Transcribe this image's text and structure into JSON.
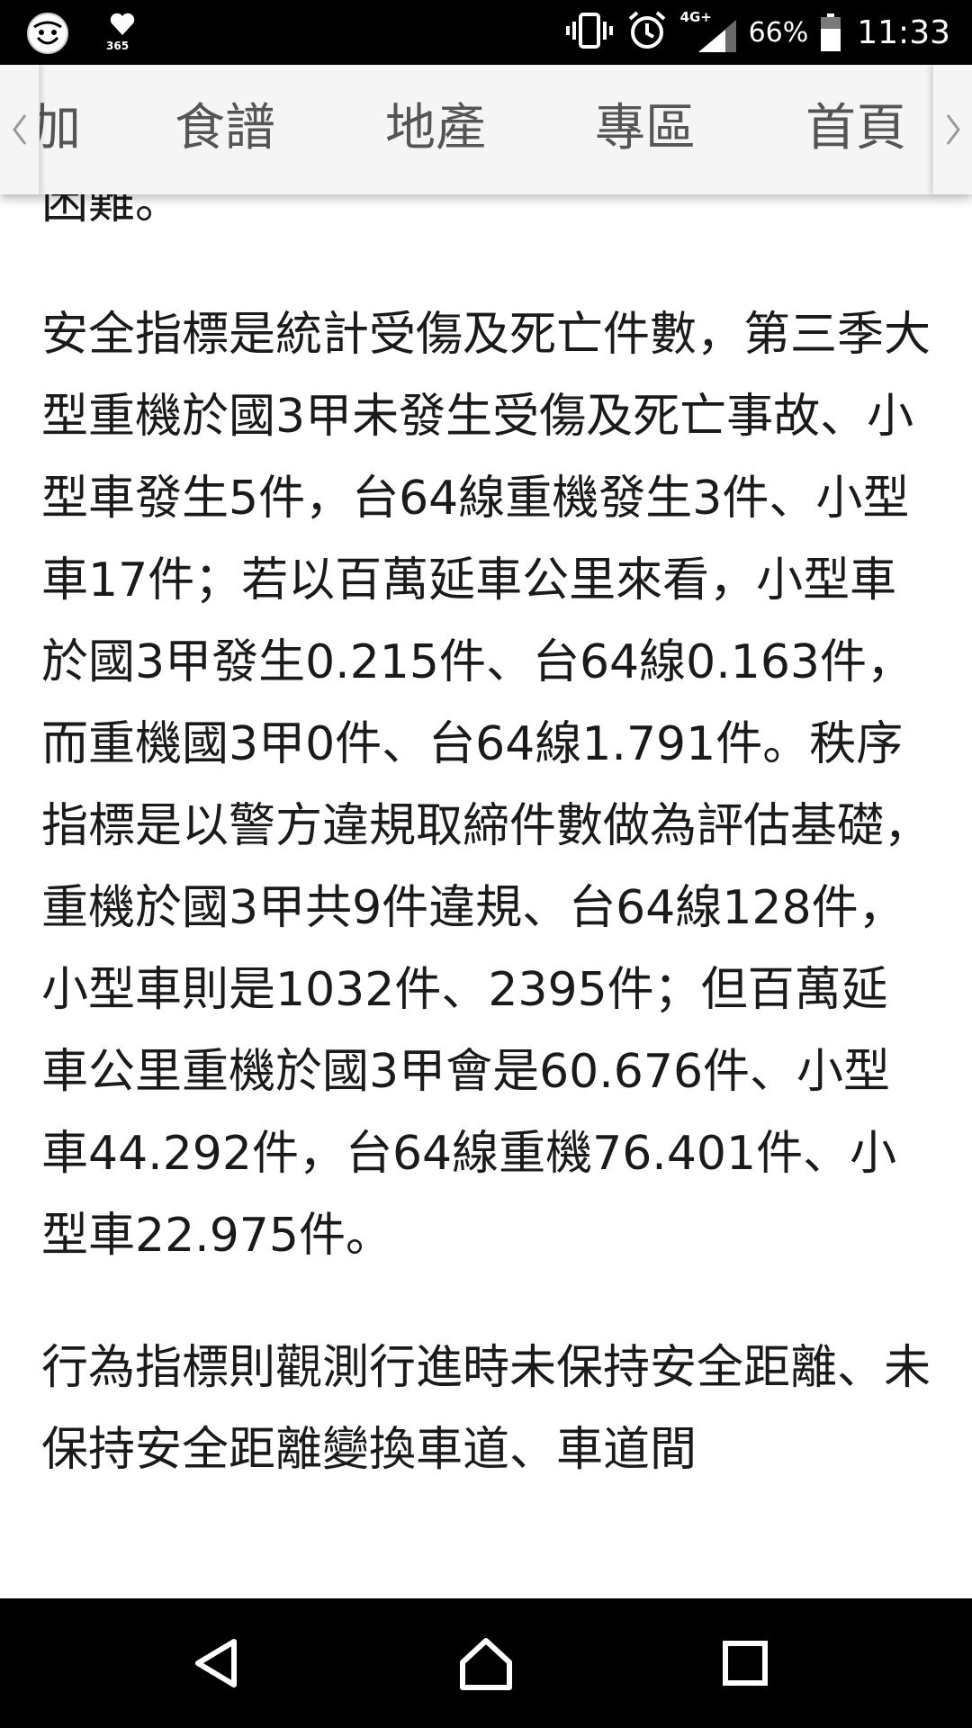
{
  "status_bar": {
    "left_icons": [
      "face-app-icon",
      "heart-365-icon"
    ],
    "heart_icon_label": "365",
    "right_icons": [
      "vibrate-icon",
      "alarm-icon",
      "signal-icon",
      "battery-icon"
    ],
    "network_type": "4G+",
    "battery_percent": "66%",
    "battery_level": 0.66,
    "time": "11:33"
  },
  "tab_bar": {
    "left_arrow_icon": "chevron-left-icon",
    "right_arrow_icon": "chevron-right-icon",
    "tabs": [
      {
        "label": "加"
      },
      {
        "label": "食譜"
      },
      {
        "label": "地產"
      },
      {
        "label": "專區"
      },
      {
        "label": "首頁"
      }
    ]
  },
  "article": {
    "paragraphs": [
      "困難。",
      "安全指標是統計受傷及死亡件數，第三季大型重機於國3甲未發生受傷及死亡事故、小型車發生5件，台64線重機發生3件、小型車17件；若以百萬延車公里來看，小型車於國3甲發生0.215件、台64線0.163件，而重機國3甲0件、台64線1.791件。秩序指標是以警方違規取締件數做為評估基礎，重機於國3甲共9件違規、台64線128件，小型車則是1032件、2395件；但百萬延車公里重機於國3甲會是60.676件、小型車44.292件，台64線重機76.401件、小型車22.975件。",
      "行為指標則觀測行進時未保持安全距離、未保持安全距離變換車道、車道間"
    ]
  },
  "nav_bar": {
    "buttons": [
      "back-icon",
      "home-icon",
      "recents-icon"
    ]
  }
}
